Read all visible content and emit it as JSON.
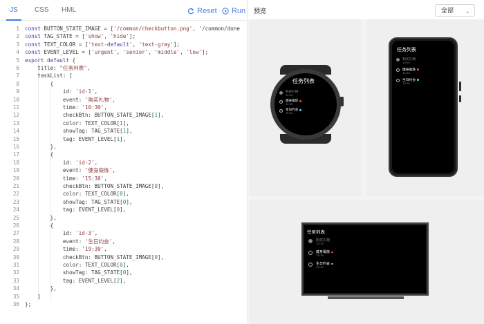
{
  "editor": {
    "tabs": [
      "JS",
      "CSS",
      "HML"
    ],
    "active_tab": "JS",
    "reset_label": "Reset",
    "run_label": "Run",
    "accent": "#4a86e8",
    "lines": [
      "const BUTTON_STATE_IMAGE = ['/common/checkbutton.png', '/common/done",
      "const TAG_STATE = ['show', 'hide'];",
      "const TEXT_COLOR = ['text-default', 'text-gray'];",
      "const EVENT_LEVEL = ['urgent', 'senior', 'middle', 'low'];",
      "export default {",
      "    title: \"任务列表\",",
      "    taskList: [",
      "        {",
      "            id: 'id-1',",
      "            event: '购买礼物',",
      "            time: '10:30',",
      "            checkBtn: BUTTON_STATE_IMAGE[1],",
      "            color: TEXT_COLOR[1],",
      "            showTag: TAG_STATE[1],",
      "            tag: EVENT_LEVEL[1],",
      "        },",
      "        {",
      "            id: 'id-2',",
      "            event: '健身锻炼',",
      "            time: '15:30',",
      "            checkBtn: BUTTON_STATE_IMAGE[0],",
      "            color: TEXT_COLOR[0],",
      "            showTag: TAG_STATE[0],",
      "            tag: EVENT_LEVEL[0],",
      "        },",
      "        {",
      "            id: 'id-3',",
      "            event: '生日约会',",
      "            time: '19:30',",
      "            checkBtn: BUTTON_STATE_IMAGE[0],",
      "            color: TEXT_COLOR[0],",
      "            showTag: TAG_STATE[0],",
      "            tag: EVENT_LEVEL[2],",
      "        },",
      "    ]",
      "};"
    ]
  },
  "preview": {
    "title": "预览",
    "device_select": "全部",
    "app_title": "任务列表",
    "tasks": [
      {
        "event": "购买礼物",
        "time": "10:30",
        "done": true,
        "gray": true,
        "tag_color": null
      },
      {
        "event": "健身锻炼",
        "time": "15:30",
        "done": false,
        "gray": false,
        "tag_color": "#e74c3c"
      },
      {
        "event": "生日约会",
        "time": "19:30",
        "done": false,
        "gray": false,
        "tag_color": "#4dd0e1"
      }
    ]
  }
}
